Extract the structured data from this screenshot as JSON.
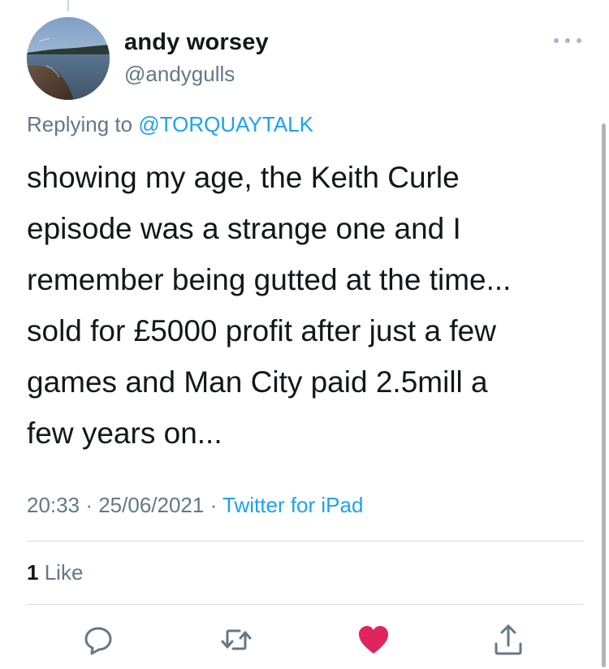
{
  "tweet": {
    "display_name": "andy worsey",
    "handle": "@andygulls",
    "replying_prefix": "Replying to",
    "replying_to": "@TORQUAYTALK",
    "text": "showing my age, the Keith Curle\nepisode was a strange one and I\nremember being gutted at the time...\nsold for £5000 profit after just a few\ngames and Man City paid 2.5mill a\nfew years on...",
    "time": "20:33",
    "separator": "·",
    "date": "25/06/2021",
    "source": "Twitter for iPad",
    "like_count": "1",
    "like_label": "Like"
  },
  "icons": {
    "more": "more-dots-icon",
    "reply": "reply-bubble-icon",
    "retweet": "retweet-icon",
    "like": "heart-filled-icon",
    "share": "share-icon"
  },
  "colors": {
    "link": "#1da1f2",
    "secondary_text": "#657786",
    "primary_text": "#14171a",
    "like_active": "#e0245e",
    "icon_gray": "#657786"
  }
}
